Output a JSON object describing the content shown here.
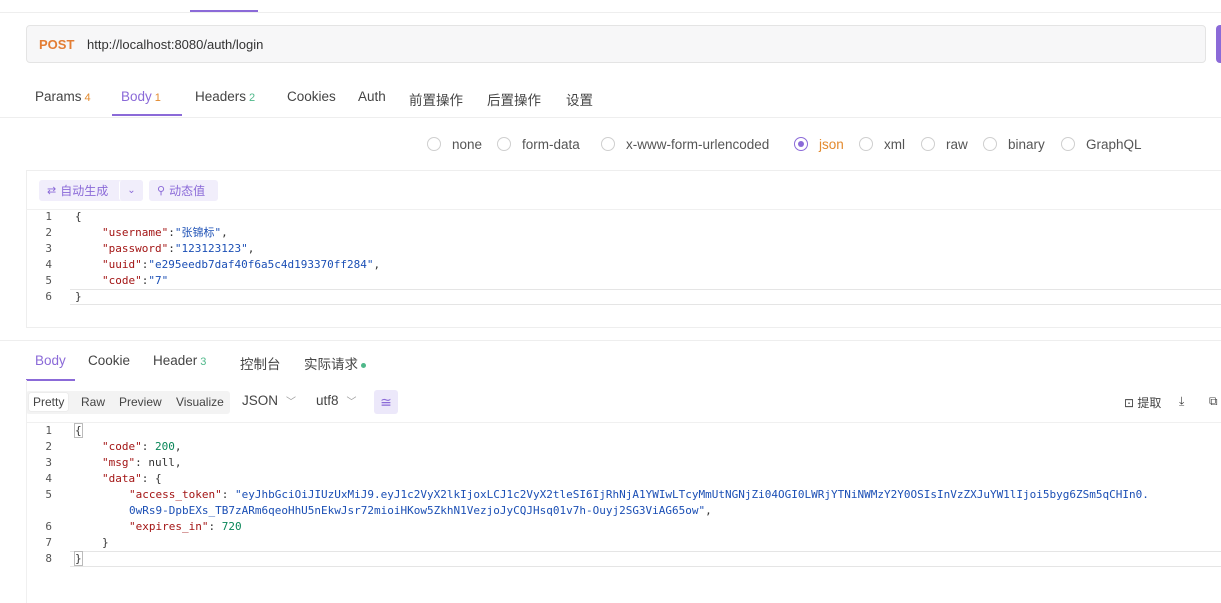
{
  "request": {
    "method": "POST",
    "url": "http://localhost:8080/auth/login"
  },
  "request_tabs": {
    "params": {
      "label": "Params",
      "count": "4"
    },
    "body": {
      "label": "Body",
      "count": "1"
    },
    "headers": {
      "label": "Headers",
      "count": "2"
    },
    "cookies": {
      "label": "Cookies"
    },
    "auth": {
      "label": "Auth"
    },
    "pre_ops": {
      "label": "前置操作"
    },
    "post_ops": {
      "label": "后置操作"
    },
    "settings": {
      "label": "设置"
    }
  },
  "body_types": {
    "options": [
      "none",
      "form-data",
      "x-www-form-urlencoded",
      "json",
      "xml",
      "raw",
      "binary",
      "GraphQL"
    ],
    "selected": "json"
  },
  "editor_toolbar": {
    "autogen_label": "自动生成",
    "dynamic_label": "动态值"
  },
  "request_body_lines": [
    {
      "n": "1",
      "open": "{"
    },
    {
      "n": "2",
      "key": "\"username\"",
      "value": "\"张锦标\"",
      "trail": ","
    },
    {
      "n": "3",
      "key": "\"password\"",
      "value": "\"123123123\"",
      "trail": ","
    },
    {
      "n": "4",
      "key": "\"uuid\"",
      "value": "\"e295eedb7daf40f6a5c4d193370ff284\"",
      "trail": ","
    },
    {
      "n": "5",
      "key": "\"code\"",
      "value": "\"7\"",
      "trail": ""
    },
    {
      "n": "6",
      "close": "}"
    }
  ],
  "response_tabs": {
    "body": {
      "label": "Body"
    },
    "cookie": {
      "label": "Cookie"
    },
    "header": {
      "label": "Header",
      "count": "3"
    },
    "console": {
      "label": "控制台"
    },
    "actual": {
      "label": "实际请求"
    }
  },
  "view_modes": {
    "pretty": "Pretty",
    "raw": "Raw",
    "preview": "Preview",
    "visualize": "Visualize"
  },
  "format_select": "JSON",
  "encoding_select": "utf8",
  "extract_label": "提取",
  "response": {
    "code": "200",
    "msg": "null",
    "access_token_1": "\"eyJhbGciOiJIUzUxMiJ9.eyJ1c2VyX2lkIjoxLCJ1c2VyX2tleSI6IjRhNjA1YWIwLTcyMmUtNGNjZi04OGI0LWRjYTNiNWMzY2Y0OSIsInVzZXJuYW1lIjoi5byg6ZSm5qCHIn0.",
    "access_token_2": "0wRs9-DpbEXs_TB7zARm6qeoHhU5nEkwJsr72mioiHKow5ZkhN1VezjoJyCQJHsq01v7h-Ouyj2SG3ViAG65ow\"",
    "expires_in": "720"
  },
  "colors": {
    "accent": "#8b6ad8",
    "method": "#e37d34",
    "count_orange": "#e38a2e",
    "count_green": "#4fb88a"
  }
}
